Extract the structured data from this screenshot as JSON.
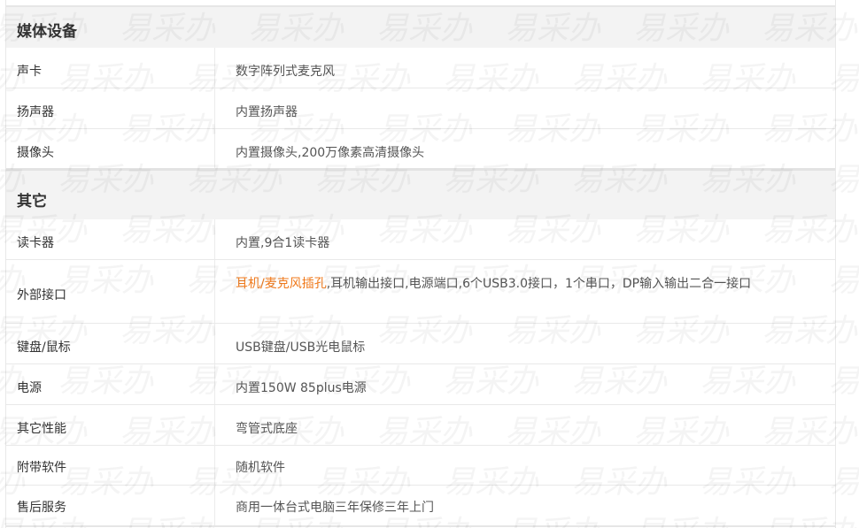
{
  "sections": [
    {
      "title": "媒体设备",
      "rows": [
        {
          "label": "声卡",
          "value": "数字阵列式麦克风"
        },
        {
          "label": "扬声器",
          "value": "内置扬声器"
        },
        {
          "label": "摄像头",
          "value": "内置摄像头,200万像素高清摄像头"
        }
      ]
    },
    {
      "title": "其它",
      "rows": [
        {
          "label": "读卡器",
          "value": "内置,9合1读卡器"
        },
        {
          "label": "外部接口",
          "value_highlight": "耳机/麦克风插孔",
          "value": ",耳机输出接口,电源端口,6个USB3.0接口，1个串口，DP输入输出二合一接口"
        },
        {
          "label": "键盘/鼠标",
          "value": "USB键盘/USB光电鼠标"
        },
        {
          "label": "电源",
          "value": "内置150W 85plus电源"
        },
        {
          "label": "其它性能",
          "value": "弯管式底座"
        },
        {
          "label": "附带软件",
          "value": "随机软件"
        },
        {
          "label": "售后服务",
          "value": "商用一体台式电脑三年保修三年上门"
        }
      ]
    }
  ],
  "watermark_text": "易采办",
  "colors": {
    "highlight": "#f07a1c",
    "header_bg": "#f3f3f3"
  }
}
